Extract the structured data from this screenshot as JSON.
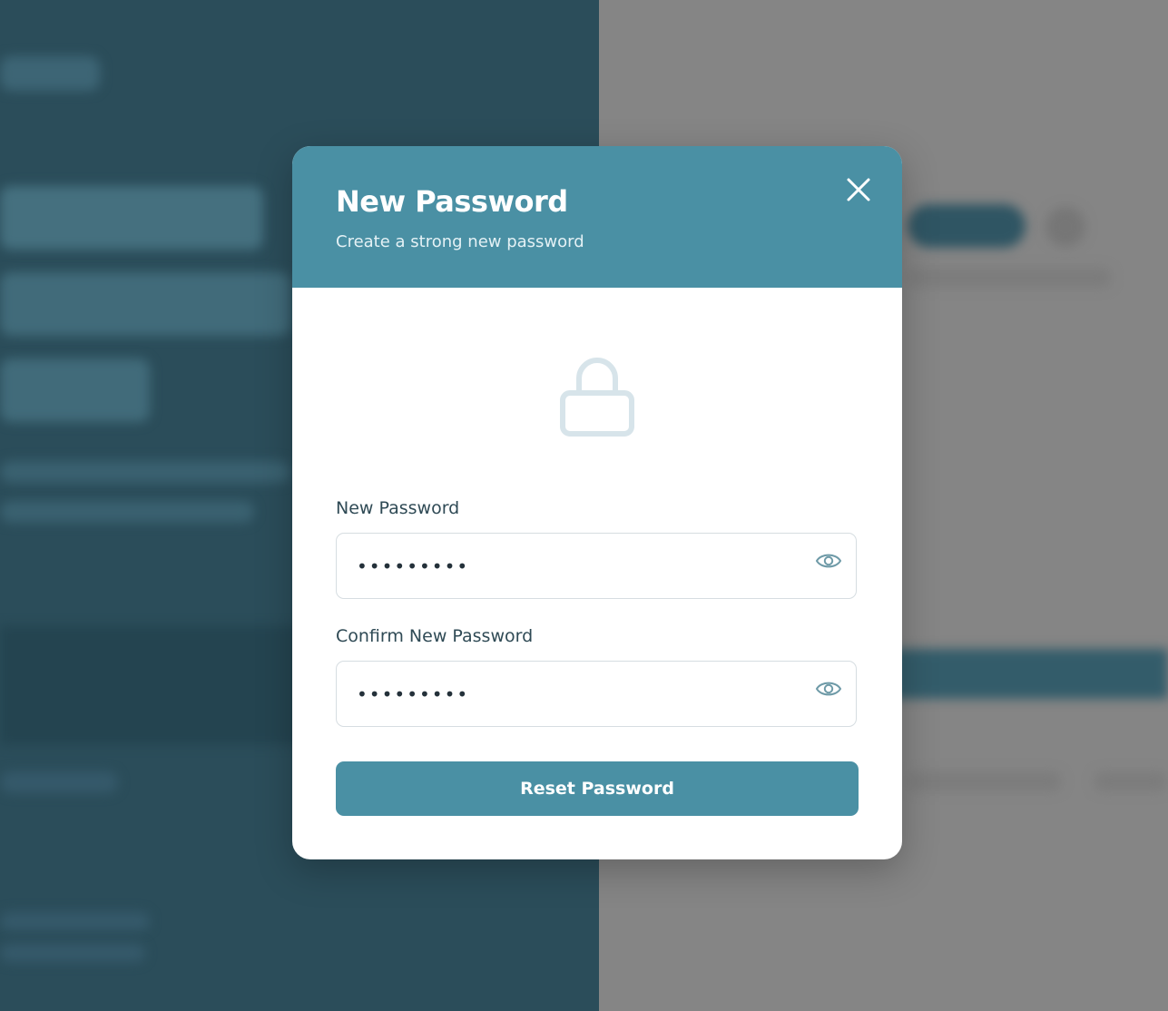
{
  "modal": {
    "title": "New Password",
    "subtitle": "Create a strong new password",
    "close_icon": "close-icon",
    "lock_icon": "lock-icon"
  },
  "form": {
    "new_password": {
      "label": "New Password",
      "value": "•••••••••",
      "toggle_icon": "eye-icon"
    },
    "confirm_password": {
      "label": "Confirm New Password",
      "value": "•••••••••",
      "toggle_icon": "eye-icon"
    },
    "submit_label": "Reset Password"
  },
  "colors": {
    "accent": "#4a90a4",
    "backdrop_left": "#2b4d5a",
    "backdrop_right": "#858585",
    "label_text": "#2f4a55",
    "input_border": "#d6dde1"
  }
}
